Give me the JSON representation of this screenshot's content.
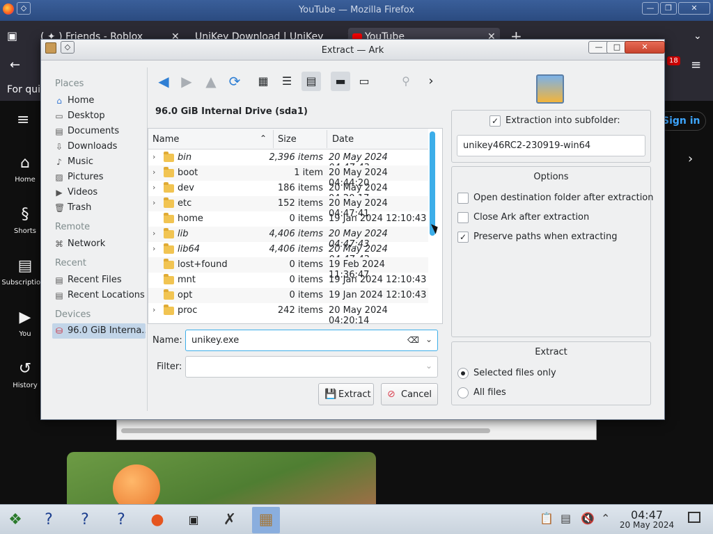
{
  "firefox": {
    "title": "YouTube — Mozilla Firefox",
    "tabs": [
      "( ✦ ) Friends - Roblox",
      "UniKey Download | UniKey",
      "YouTube"
    ],
    "new_tab": "+",
    "notice": "For qui",
    "youtube": {
      "sign_in": "Sign in",
      "nav": [
        "Home",
        "Shorts",
        "Subscriptions",
        "You",
        "History"
      ],
      "badge": "18"
    }
  },
  "dialog": {
    "title": "Extract — Ark",
    "places": {
      "sections": [
        "Places",
        "Remote",
        "Recent",
        "Devices"
      ],
      "places_items": [
        "Home",
        "Desktop",
        "Documents",
        "Downloads",
        "Music",
        "Pictures",
        "Videos",
        "Trash"
      ],
      "remote_items": [
        "Network"
      ],
      "recent_items": [
        "Recent Files",
        "Recent Locations"
      ],
      "device_items": [
        "96.0 GiB Interna..."
      ]
    },
    "location": "96.0 GiB Internal Drive (sda1)",
    "columns": {
      "name": "Name",
      "size": "Size",
      "date": "Date"
    },
    "files": [
      {
        "name": "bin",
        "size": "2,396 items",
        "date": "20 May 2024 04:47:43"
      },
      {
        "name": "boot",
        "size": "1 item",
        "date": "20 May 2024 04:44:20"
      },
      {
        "name": "dev",
        "size": "186 items",
        "date": "20 May 2024 04:20:17"
      },
      {
        "name": "etc",
        "size": "152 items",
        "date": "20 May 2024 04:47:41"
      },
      {
        "name": "home",
        "size": "0 items",
        "date": "19 Jan 2024 12:10:43"
      },
      {
        "name": "lib",
        "size": "4,406 items",
        "date": "20 May 2024 04:47:43"
      },
      {
        "name": "lib64",
        "size": "4,406 items",
        "date": "20 May 2024 04:47:43"
      },
      {
        "name": "lost+found",
        "size": "0 items",
        "date": "19 Feb 2024 11:36:47"
      },
      {
        "name": "mnt",
        "size": "0 items",
        "date": "19 Jan 2024 12:10:43"
      },
      {
        "name": "opt",
        "size": "0 items",
        "date": "19 Jan 2024 12:10:43"
      },
      {
        "name": "proc",
        "size": "242 items",
        "date": "20 May 2024 04:20:14"
      }
    ],
    "name_label": "Name:",
    "name_value": "unikey.exe",
    "filter_label": "Filter:",
    "extract_button": "Extract",
    "cancel_button": "Cancel",
    "subfolder_label": "Extraction into subfolder:",
    "subfolder_value": "unikey46RC2-230919-win64",
    "options_title": "Options",
    "options": [
      {
        "label": "Open destination folder after extraction",
        "checked": false
      },
      {
        "label": "Close Ark after extraction",
        "checked": false
      },
      {
        "label": "Preserve paths when extracting",
        "checked": true
      }
    ],
    "extract_title": "Extract",
    "extract_modes": [
      {
        "label": "Selected files only",
        "selected": true
      },
      {
        "label": "All files",
        "selected": false
      }
    ]
  },
  "taskbar": {
    "time": "04:47",
    "date": "20 May 2024"
  },
  "colors": {
    "accent": "#3daee9",
    "dialog_bg": "#eff0f1",
    "youtube_bg": "#0f0f0f",
    "firefox_title": "#2b4b80"
  }
}
